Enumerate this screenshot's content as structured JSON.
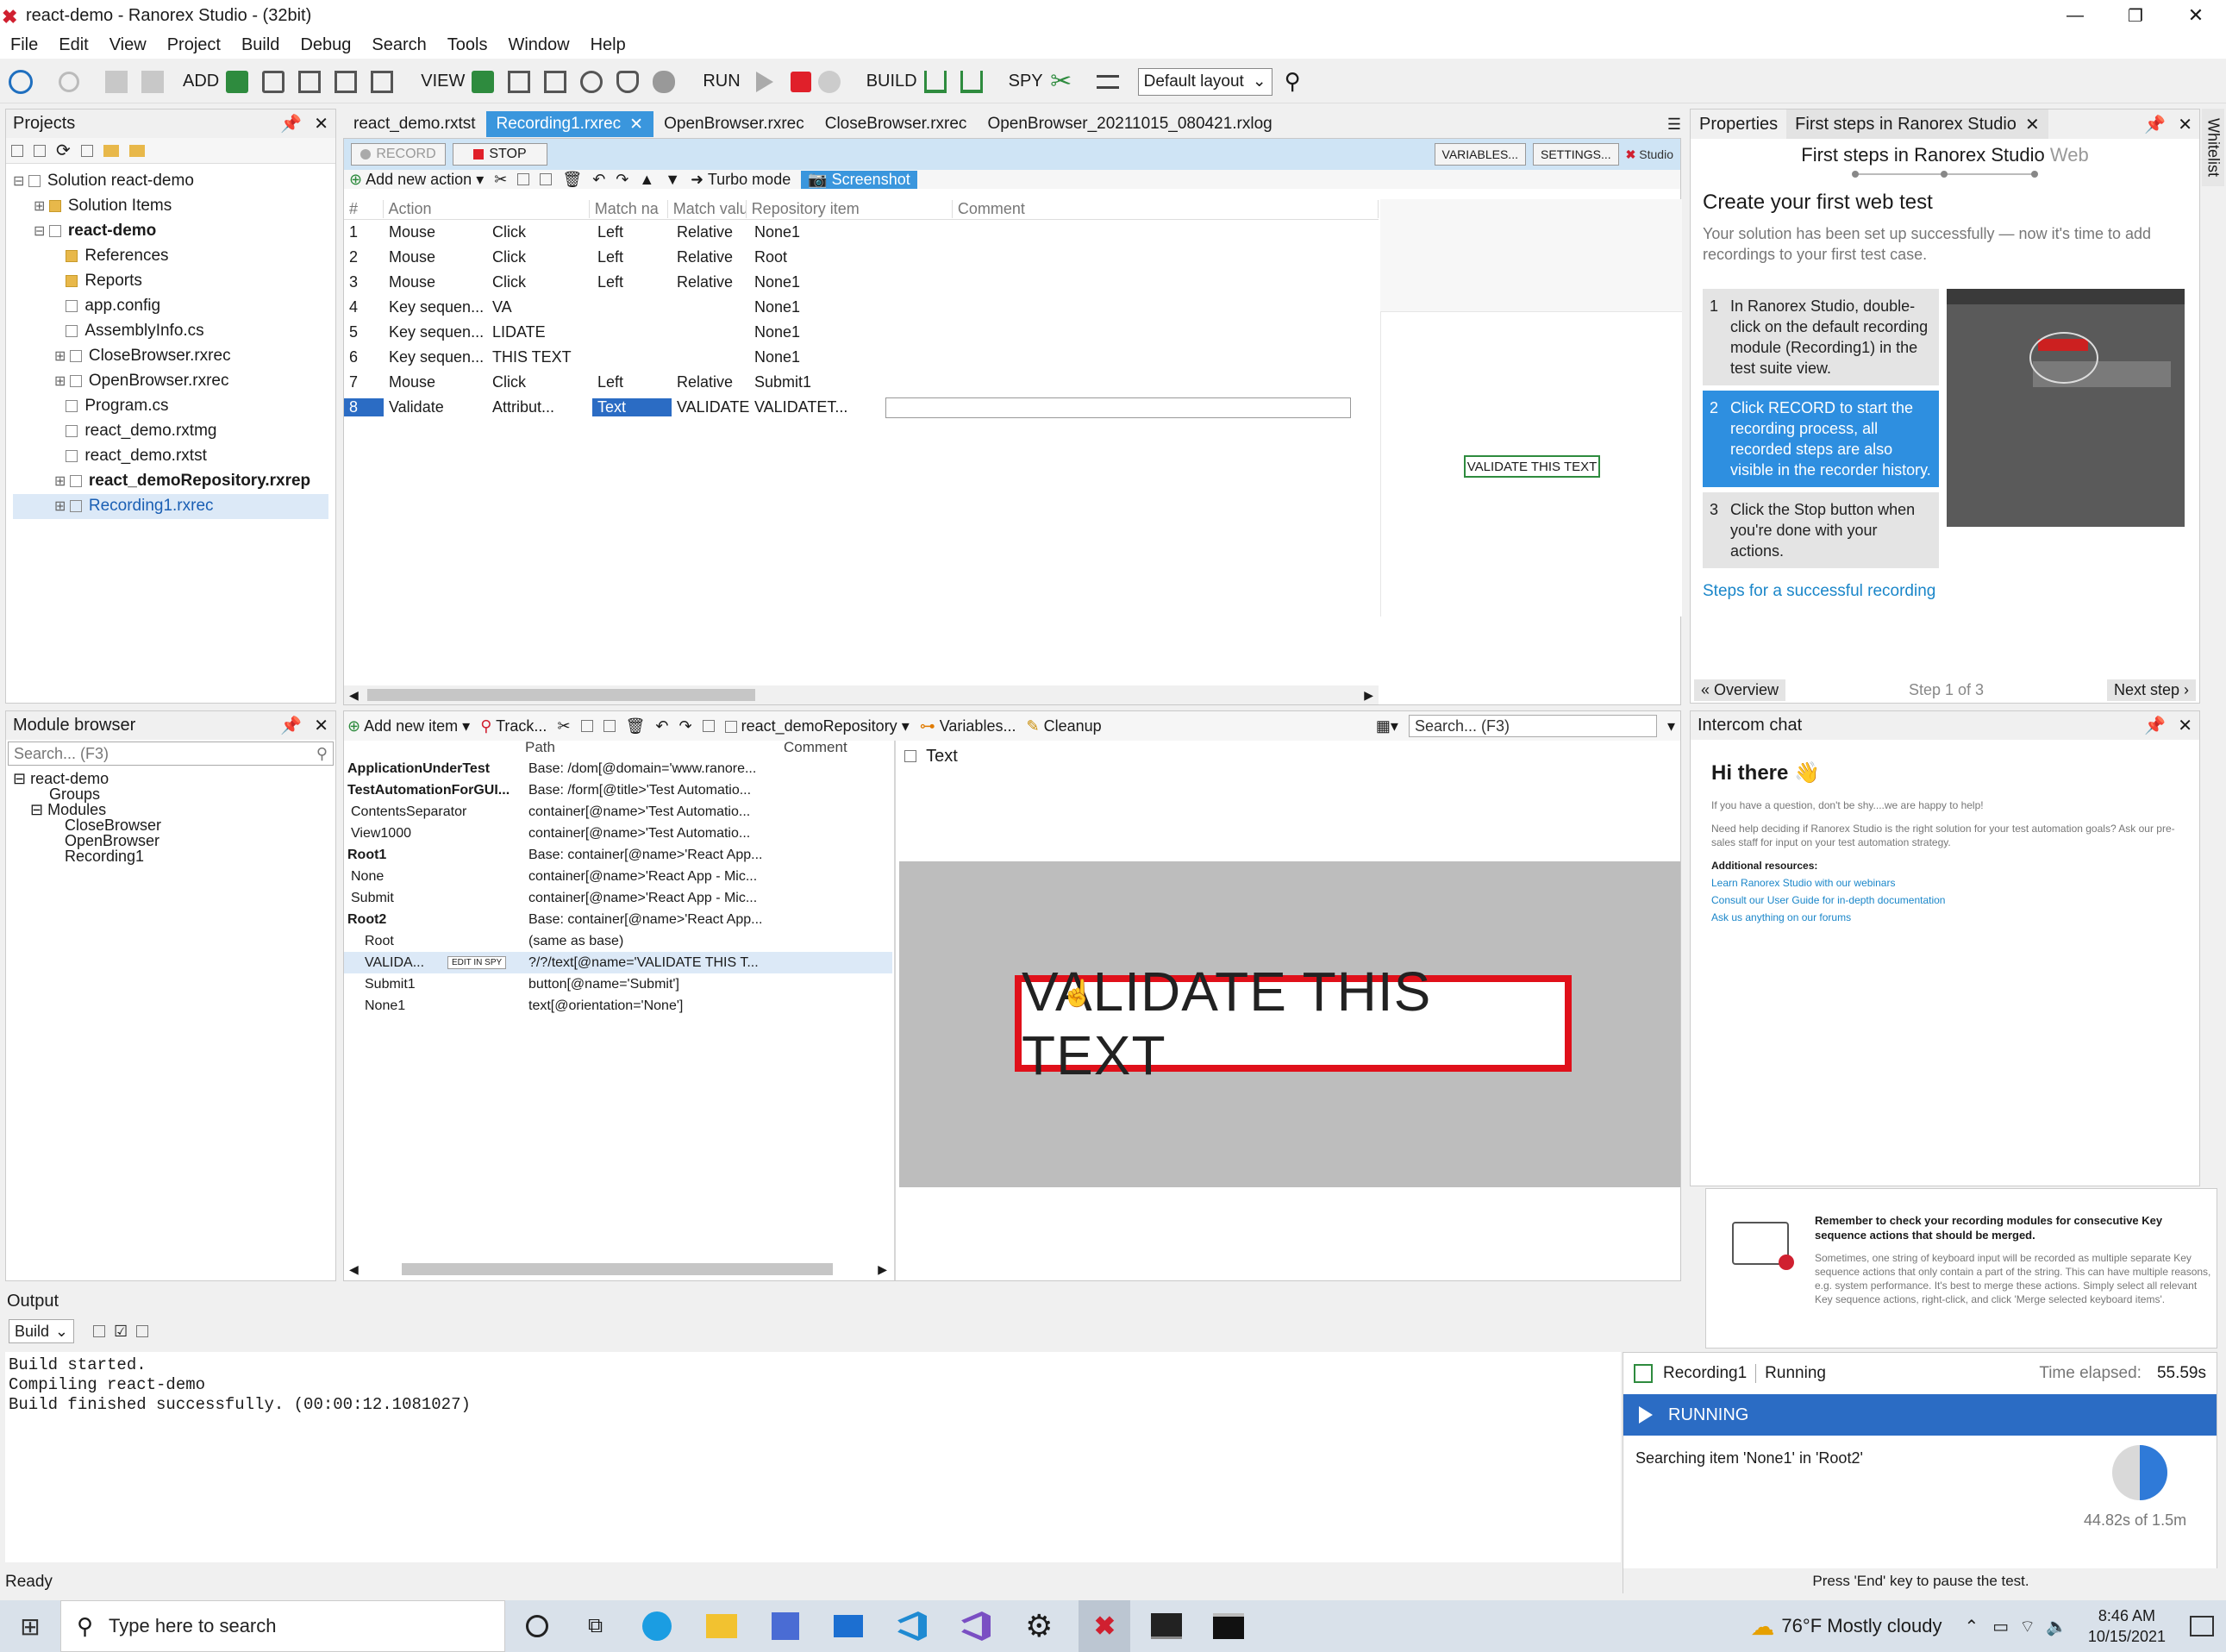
{
  "window": {
    "title": "react-demo - Ranorex Studio - (32bit)",
    "minimize": "—",
    "restore": "❐",
    "close": "✕"
  },
  "menu": [
    "File",
    "Edit",
    "View",
    "Project",
    "Build",
    "Debug",
    "Search",
    "Tools",
    "Window",
    "Help"
  ],
  "toolbar": {
    "add": "ADD",
    "view": "VIEW",
    "run": "RUN",
    "build": "BUILD",
    "spy": "SPY",
    "layout": "Default layout"
  },
  "projects": {
    "title": "Projects",
    "items": [
      {
        "label": "Solution react-demo",
        "indent": 0,
        "bold": false
      },
      {
        "label": "Solution Items",
        "indent": 1,
        "bold": false
      },
      {
        "label": "react-demo",
        "indent": 1,
        "bold": true
      },
      {
        "label": "References",
        "indent": 2,
        "bold": false
      },
      {
        "label": "Reports",
        "indent": 2,
        "bold": false
      },
      {
        "label": "app.config",
        "indent": 2,
        "bold": false
      },
      {
        "label": "AssemblyInfo.cs",
        "indent": 2,
        "bold": false
      },
      {
        "label": "CloseBrowser.rxrec",
        "indent": 2,
        "bold": false
      },
      {
        "label": "OpenBrowser.rxrec",
        "indent": 2,
        "bold": false
      },
      {
        "label": "Program.cs",
        "indent": 2,
        "bold": false
      },
      {
        "label": "react_demo.rxtmg",
        "indent": 2,
        "bold": false
      },
      {
        "label": "react_demo.rxtst",
        "indent": 2,
        "bold": false
      },
      {
        "label": "react_demoRepository.rxrep",
        "indent": 2,
        "bold": true
      },
      {
        "label": "Recording1.rxrec",
        "indent": 2,
        "bold": false
      }
    ]
  },
  "doc_tabs": [
    "react_demo.rxtst",
    "Recording1.rxrec",
    "OpenBrowser.rxrec",
    "CloseBrowser.rxrec",
    "OpenBrowser_20211015_080421.rxlog"
  ],
  "recorder": {
    "record": "RECORD",
    "stop": "STOP",
    "variables": "VARIABLES...",
    "settings": "SETTINGS...",
    "studio": "Studio",
    "add_action": "Add new action",
    "turbo": "Turbo mode",
    "screenshot": "Screenshot"
  },
  "actions": {
    "headers": [
      "#",
      "Action",
      "Match na",
      "Match valu",
      "Repository item",
      "Comment"
    ],
    "rows": [
      [
        "1",
        "Mouse",
        "Click",
        "Left",
        "Relative",
        "None1"
      ],
      [
        "2",
        "Mouse",
        "Click",
        "Left",
        "Relative",
        "Root"
      ],
      [
        "3",
        "Mouse",
        "Click",
        "Left",
        "Relative",
        "None1"
      ],
      [
        "4",
        "Key sequen...",
        "VA",
        "",
        "",
        "None1"
      ],
      [
        "5",
        "Key sequen...",
        "LIDATE",
        "",
        "",
        "None1"
      ],
      [
        "6",
        "Key sequen...",
        "THIS TEXT",
        "",
        "",
        "None1"
      ],
      [
        "7",
        "Mouse",
        "Click",
        "Left",
        "Relative",
        "Submit1"
      ],
      [
        "8",
        "Validate",
        "Attribut...",
        "Text",
        "VALIDATE",
        "VALIDATET..."
      ]
    ]
  },
  "preview_thumb": "VALIDATE THIS TEXT",
  "first_steps": {
    "tab_props": "Properties",
    "tab_fs": "First steps in Ranorex Studio",
    "title_a": "First steps in Ranorex Studio",
    "title_b": "Web",
    "heading": "Create your first web test",
    "intro": "Your solution has been set up successfully — now it's time to add recordings to your first test case.",
    "steps": [
      {
        "n": "1",
        "text": "In Ranorex Studio, double-click on the default recording module (Recording1) in the test suite view."
      },
      {
        "n": "2",
        "text": "Click RECORD to start the recording process, all recorded steps are also visible in the recorder history."
      },
      {
        "n": "3",
        "text": "Click the Stop button when you're done with your actions."
      }
    ],
    "link": "Steps for a successful recording",
    "overview": "« Overview",
    "step": "Step 1 of 3",
    "next": "Next step ›"
  },
  "module_browser": {
    "title": "Module browser",
    "search": "Search... (F3)",
    "items": [
      "react-demo",
      "Groups",
      "Modules",
      "CloseBrowser",
      "OpenBrowser",
      "Recording1"
    ]
  },
  "repo": {
    "add_item": "Add new item",
    "track": "Track...",
    "repo_name": "react_demoRepository",
    "variables": "Variables...",
    "cleanup": "Cleanup",
    "search": "Search... (F3)",
    "headers": [
      "Path",
      "Comment"
    ],
    "rows": [
      {
        "name": "ApplicationUnderTest",
        "path": "Base: /dom[@domain='www.ranore...",
        "bold": true
      },
      {
        "name": "TestAutomationForGUI...",
        "path": "Base: /form[@title>'Test Automatio...",
        "bold": true
      },
      {
        "name": "ContentsSeparator",
        "path": "container[@name>'Test Automatio...",
        "bold": false
      },
      {
        "name": "View1000",
        "path": "container[@name>'Test Automatio...",
        "bold": false
      },
      {
        "name": "Root1",
        "path": "Base: container[@name>'React App...",
        "bold": true
      },
      {
        "name": "None",
        "path": "container[@name>'React App - Mic...",
        "bold": false
      },
      {
        "name": "Submit",
        "path": "container[@name>'React App - Mic...",
        "bold": false
      },
      {
        "name": "Root2",
        "path": "Base: container[@name>'React App...",
        "bold": true
      },
      {
        "name": "Root",
        "path": "(same as base)",
        "bold": false
      },
      {
        "name": "VALIDA...",
        "path": "?/?/text[@name='VALIDATE THIS T...",
        "bold": false
      },
      {
        "name": "Submit1",
        "path": "button[@name='Submit']",
        "bold": false
      },
      {
        "name": "None1",
        "path": "text[@orientation='None']",
        "bold": false
      }
    ],
    "edit_in_spy": "EDIT IN SPY",
    "detail_title": "Text",
    "screenshot_text": "VALIDATE THIS TEXT"
  },
  "intercom": {
    "title": "Intercom chat",
    "hi": "Hi there 👋",
    "p1": "If you have a question, don't be shy....we are happy to help!",
    "p2": "Need help deciding if Ranorex Studio is the right solution for your test automation goals? Ask our pre-sales staff for input on your test automation strategy.",
    "res": "Additional resources:",
    "l1": "Learn Ranorex Studio with our webinars",
    "l2": "Consult our User Guide for in-depth documentation",
    "l3": "Ask us anything on our forums"
  },
  "tip": {
    "title": "Remember to check your recording modules for consecutive Key sequence actions that should be merged.",
    "body": "Sometimes, one string of keyboard input will be recorded as multiple separate Key sequence actions that only contain a part of the string. This can have multiple reasons, e.g. system performance. It's best to merge these actions. Simply select all relevant Key sequence actions, right-click, and click 'Merge selected keyboard items'."
  },
  "output": {
    "title": "Output",
    "select": "Build",
    "lines": [
      "Build started.",
      "Compiling react-demo",
      "Build finished successfully. (00:00:12.1081027)"
    ]
  },
  "runner": {
    "module": "Recording1",
    "state": "Running",
    "elapsed_label": "Time elapsed:",
    "elapsed": "55.59s",
    "running": "RUNNING",
    "searching": "Searching item 'None1' in 'Root2'",
    "progress": "44.82s of 1.5m",
    "progress_fraction": 0.5,
    "hint": "Press 'End' key to pause the test."
  },
  "status": {
    "text": "Ready"
  },
  "side_tab": "Whitelist",
  "taskbar": {
    "search": "Type here to search",
    "weather": "76°F  Mostly cloudy",
    "time": "8:46 AM",
    "date": "10/15/2021"
  }
}
